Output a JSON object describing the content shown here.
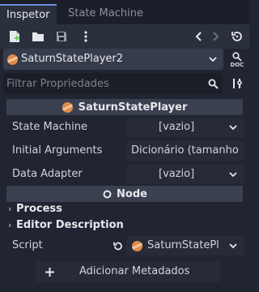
{
  "tabs": [
    "Inspetor",
    "State Machine"
  ],
  "toolbar": {
    "icons": [
      "new-resource-icon",
      "open-folder-icon",
      "save-icon",
      "more-options-icon",
      "history-back-icon",
      "history-forward-icon",
      "object-history-icon"
    ]
  },
  "object_selector": {
    "name": "SaturnStatePlayer2"
  },
  "doc_label": "DOC",
  "filter": {
    "placeholder": "Filtrar Propriedades"
  },
  "class_header": "SaturnStatePlayer",
  "properties": [
    {
      "label": "State Machine",
      "value": "[vazio]"
    },
    {
      "label": "Initial Arguments",
      "value": "Dicionário (tamanho"
    },
    {
      "label": "Data Adapter",
      "value": "[vazio]"
    }
  ],
  "node_header": "Node",
  "groups": [
    "Process",
    "Editor Description"
  ],
  "script": {
    "label": "Script",
    "value": "SaturnStatePl"
  },
  "add_metadata": "Adicionar Metadados"
}
